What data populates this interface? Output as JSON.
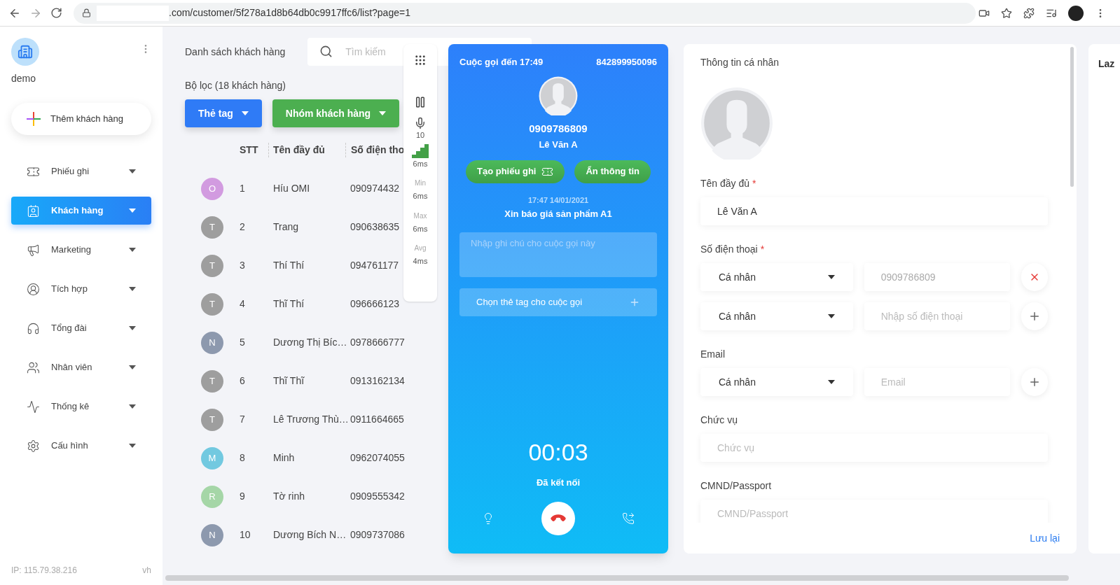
{
  "browser": {
    "url": ".com/customer/5f278a1d8b64db0c9917ffc6/list?page=1"
  },
  "sidebar": {
    "account": "demo",
    "add_button": "Thêm khách hàng",
    "items": [
      {
        "label": "Phiếu ghi",
        "selected": false
      },
      {
        "label": "Khách hàng",
        "selected": true
      },
      {
        "label": "Marketing",
        "selected": false
      },
      {
        "label": "Tích hợp",
        "selected": false
      },
      {
        "label": "Tổng đài",
        "selected": false
      },
      {
        "label": "Nhân viên",
        "selected": false
      },
      {
        "label": "Thống kê",
        "selected": false
      },
      {
        "label": "Cấu hình",
        "selected": false
      }
    ],
    "ip": "IP: 115.79.38.216",
    "user": "vh"
  },
  "list": {
    "title": "Danh sách khách hàng",
    "search": {
      "placeholder": "Tìm kiếm"
    },
    "filter_label": "Bộ lọc (18 khách hàng)",
    "filters": [
      {
        "label": "Thẻ tag",
        "color": "#2f7bf6"
      },
      {
        "label": "Nhóm khách hàng",
        "color": "#4caf50"
      }
    ],
    "columns": [
      "STT",
      "Tên đầy đủ",
      "Số điện tho"
    ],
    "rows": [
      {
        "initial": "O",
        "color": "#d29be0",
        "stt": "1",
        "name": "Híu OMI",
        "phone": "090974432"
      },
      {
        "initial": "T",
        "color": "#9e9e9e",
        "stt": "2",
        "name": "Trang",
        "phone": "090638635"
      },
      {
        "initial": "T",
        "color": "#9e9e9e",
        "stt": "3",
        "name": "Thí Thí",
        "phone": "094761177"
      },
      {
        "initial": "T",
        "color": "#9e9e9e",
        "stt": "4",
        "name": "Thĩ Thí",
        "phone": "096666123"
      },
      {
        "initial": "N",
        "color": "#8d99ae",
        "stt": "5",
        "name": "Dương Thị Bíc…",
        "phone": "0978666777"
      },
      {
        "initial": "T",
        "color": "#9e9e9e",
        "stt": "6",
        "name": "Thĩ Thĩ",
        "phone": "0913162134"
      },
      {
        "initial": "T",
        "color": "#9e9e9e",
        "stt": "7",
        "name": "Lê Trương Thù…",
        "phone": "0911664665"
      },
      {
        "initial": "M",
        "color": "#72c9e0",
        "stt": "8",
        "name": "Minh",
        "phone": "0962074055"
      },
      {
        "initial": "R",
        "color": "#a5d6a7",
        "stt": "9",
        "name": "Tờ rinh",
        "phone": "0909555342"
      },
      {
        "initial": "N",
        "color": "#8d99ae",
        "stt": "10",
        "name": "Dương Bích N…",
        "phone": "0909737086"
      }
    ]
  },
  "call_stats": {
    "mic": "10",
    "ping": "6ms",
    "stats": [
      {
        "label": "Min",
        "value": "6ms"
      },
      {
        "label": "Max",
        "value": "6ms"
      },
      {
        "label": "Avg",
        "value": "4ms"
      }
    ]
  },
  "call": {
    "title": "Cuộc gọi đến 17:49",
    "line": "842899950096",
    "phone": "0909786809",
    "name": "Lê Văn A",
    "actions": [
      "Tạo phiếu ghi",
      "Ẩn thông tin"
    ],
    "time": "17:47 14/01/2021",
    "subject": "Xin báo giá sản phẩm A1",
    "note": {
      "placeholder": "Nhập ghi chú cho cuộc gọi này"
    },
    "tag_button": "Chọn thẻ tag cho cuộc gọi",
    "timer": "00:03",
    "status": "Đã kết nối"
  },
  "info": {
    "title": "Thông tin cá nhân",
    "fields": [
      {
        "kind": "text",
        "label": "Tên đầy đủ",
        "required_mark": "*",
        "value": "Lê Văn A"
      },
      {
        "kind": "multi",
        "label": "Số điện thoại",
        "required_mark": "*",
        "rows": [
          {
            "type": "Cá nhân",
            "value": "0909786809",
            "kind": "remove"
          },
          {
            "type": "Cá nhân",
            "placeholder": "Nhập số điện thoại",
            "kind": "add"
          }
        ]
      },
      {
        "kind": "multi",
        "label": "Email",
        "rows": [
          {
            "type": "Cá nhân",
            "placeholder": "Email",
            "kind": "add"
          }
        ]
      },
      {
        "kind": "text",
        "label": "Chức vụ",
        "placeholder": "Chức vụ"
      },
      {
        "kind": "text",
        "label": "CMND/Passport",
        "placeholder": "CMND/Passport"
      }
    ],
    "save": "Lưu lại"
  },
  "side_panel": {
    "title": "Laz"
  }
}
